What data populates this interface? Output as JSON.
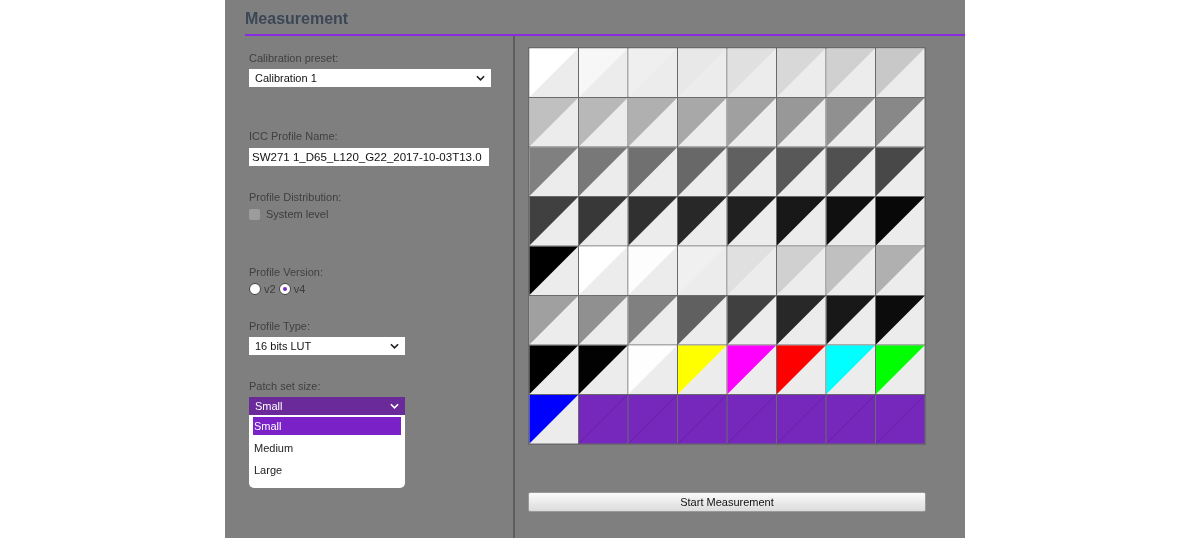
{
  "title": "Measurement",
  "form": {
    "calibration_preset": {
      "label": "Calibration preset:",
      "value": "Calibration 1"
    },
    "icc_profile_name": {
      "label": "ICC Profile Name:",
      "value": "SW271 1_D65_L120_G22_2017-10-03T13.0"
    },
    "profile_distribution": {
      "label": "Profile Distribution:",
      "option": "System level",
      "checked": false
    },
    "profile_version": {
      "label": "Profile Version:",
      "options": [
        {
          "label": "v2",
          "selected": false
        },
        {
          "label": "v4",
          "selected": true
        }
      ]
    },
    "profile_type": {
      "label": "Profile Type:",
      "value": "16 bits LUT"
    },
    "patch_set_size": {
      "label": "Patch set size:",
      "value": "Small",
      "expanded": true,
      "options": [
        {
          "label": "Small",
          "selected": true
        },
        {
          "label": "Medium",
          "selected": false
        },
        {
          "label": "Large",
          "selected": false
        }
      ]
    }
  },
  "patches": [
    {
      "kind": "patch",
      "color": "#ffffff"
    },
    {
      "kind": "patch",
      "color": "#f7f7f7"
    },
    {
      "kind": "patch",
      "color": "#efefef"
    },
    {
      "kind": "patch",
      "color": "#e8e8e8"
    },
    {
      "kind": "patch",
      "color": "#e0e0e0"
    },
    {
      "kind": "patch",
      "color": "#d8d8d8"
    },
    {
      "kind": "patch",
      "color": "#d0d0d0"
    },
    {
      "kind": "patch",
      "color": "#c8c8c8"
    },
    {
      "kind": "patch",
      "color": "#c0c0c0"
    },
    {
      "kind": "patch",
      "color": "#b8b8b8"
    },
    {
      "kind": "patch",
      "color": "#b0b0b0"
    },
    {
      "kind": "patch",
      "color": "#a8a8a8"
    },
    {
      "kind": "patch",
      "color": "#a0a0a0"
    },
    {
      "kind": "patch",
      "color": "#989898"
    },
    {
      "kind": "patch",
      "color": "#909090"
    },
    {
      "kind": "patch",
      "color": "#888888"
    },
    {
      "kind": "patch",
      "color": "#808080"
    },
    {
      "kind": "patch",
      "color": "#787878"
    },
    {
      "kind": "patch",
      "color": "#707070"
    },
    {
      "kind": "patch",
      "color": "#686868"
    },
    {
      "kind": "patch",
      "color": "#606060"
    },
    {
      "kind": "patch",
      "color": "#585858"
    },
    {
      "kind": "patch",
      "color": "#505050"
    },
    {
      "kind": "patch",
      "color": "#484848"
    },
    {
      "kind": "patch",
      "color": "#404040"
    },
    {
      "kind": "patch",
      "color": "#383838"
    },
    {
      "kind": "patch",
      "color": "#303030"
    },
    {
      "kind": "patch",
      "color": "#282828"
    },
    {
      "kind": "patch",
      "color": "#202020"
    },
    {
      "kind": "patch",
      "color": "#181818"
    },
    {
      "kind": "patch",
      "color": "#101010"
    },
    {
      "kind": "patch",
      "color": "#080808"
    },
    {
      "kind": "patch",
      "color": "#000000"
    },
    {
      "kind": "patch",
      "color": "#ffffff"
    },
    {
      "kind": "patch",
      "color": "#fdfdfd"
    },
    {
      "kind": "patch",
      "color": "#f0f0f0"
    },
    {
      "kind": "patch",
      "color": "#e0e0e0"
    },
    {
      "kind": "patch",
      "color": "#d0d0d0"
    },
    {
      "kind": "patch",
      "color": "#c0c0c0"
    },
    {
      "kind": "patch",
      "color": "#b0b0b0"
    },
    {
      "kind": "patch",
      "color": "#a0a0a0"
    },
    {
      "kind": "patch",
      "color": "#909090"
    },
    {
      "kind": "patch",
      "color": "#808080"
    },
    {
      "kind": "patch",
      "color": "#606060"
    },
    {
      "kind": "patch",
      "color": "#404040"
    },
    {
      "kind": "patch",
      "color": "#282828"
    },
    {
      "kind": "patch",
      "color": "#181818"
    },
    {
      "kind": "patch",
      "color": "#0c0c0c"
    },
    {
      "kind": "patch",
      "color": "#000000"
    },
    {
      "kind": "patch",
      "color": "#020202"
    },
    {
      "kind": "patch",
      "color": "#fefefe"
    },
    {
      "kind": "patch",
      "color": "#ffff00"
    },
    {
      "kind": "patch",
      "color": "#ff00ff"
    },
    {
      "kind": "patch",
      "color": "#ff0000"
    },
    {
      "kind": "patch",
      "color": "#00ffff"
    },
    {
      "kind": "patch",
      "color": "#00ff00"
    },
    {
      "kind": "patch",
      "color": "#0000ff"
    },
    {
      "kind": "empty"
    },
    {
      "kind": "empty"
    },
    {
      "kind": "empty"
    },
    {
      "kind": "empty"
    },
    {
      "kind": "empty"
    },
    {
      "kind": "empty"
    },
    {
      "kind": "empty"
    }
  ],
  "start_button": "Start Measurement"
}
